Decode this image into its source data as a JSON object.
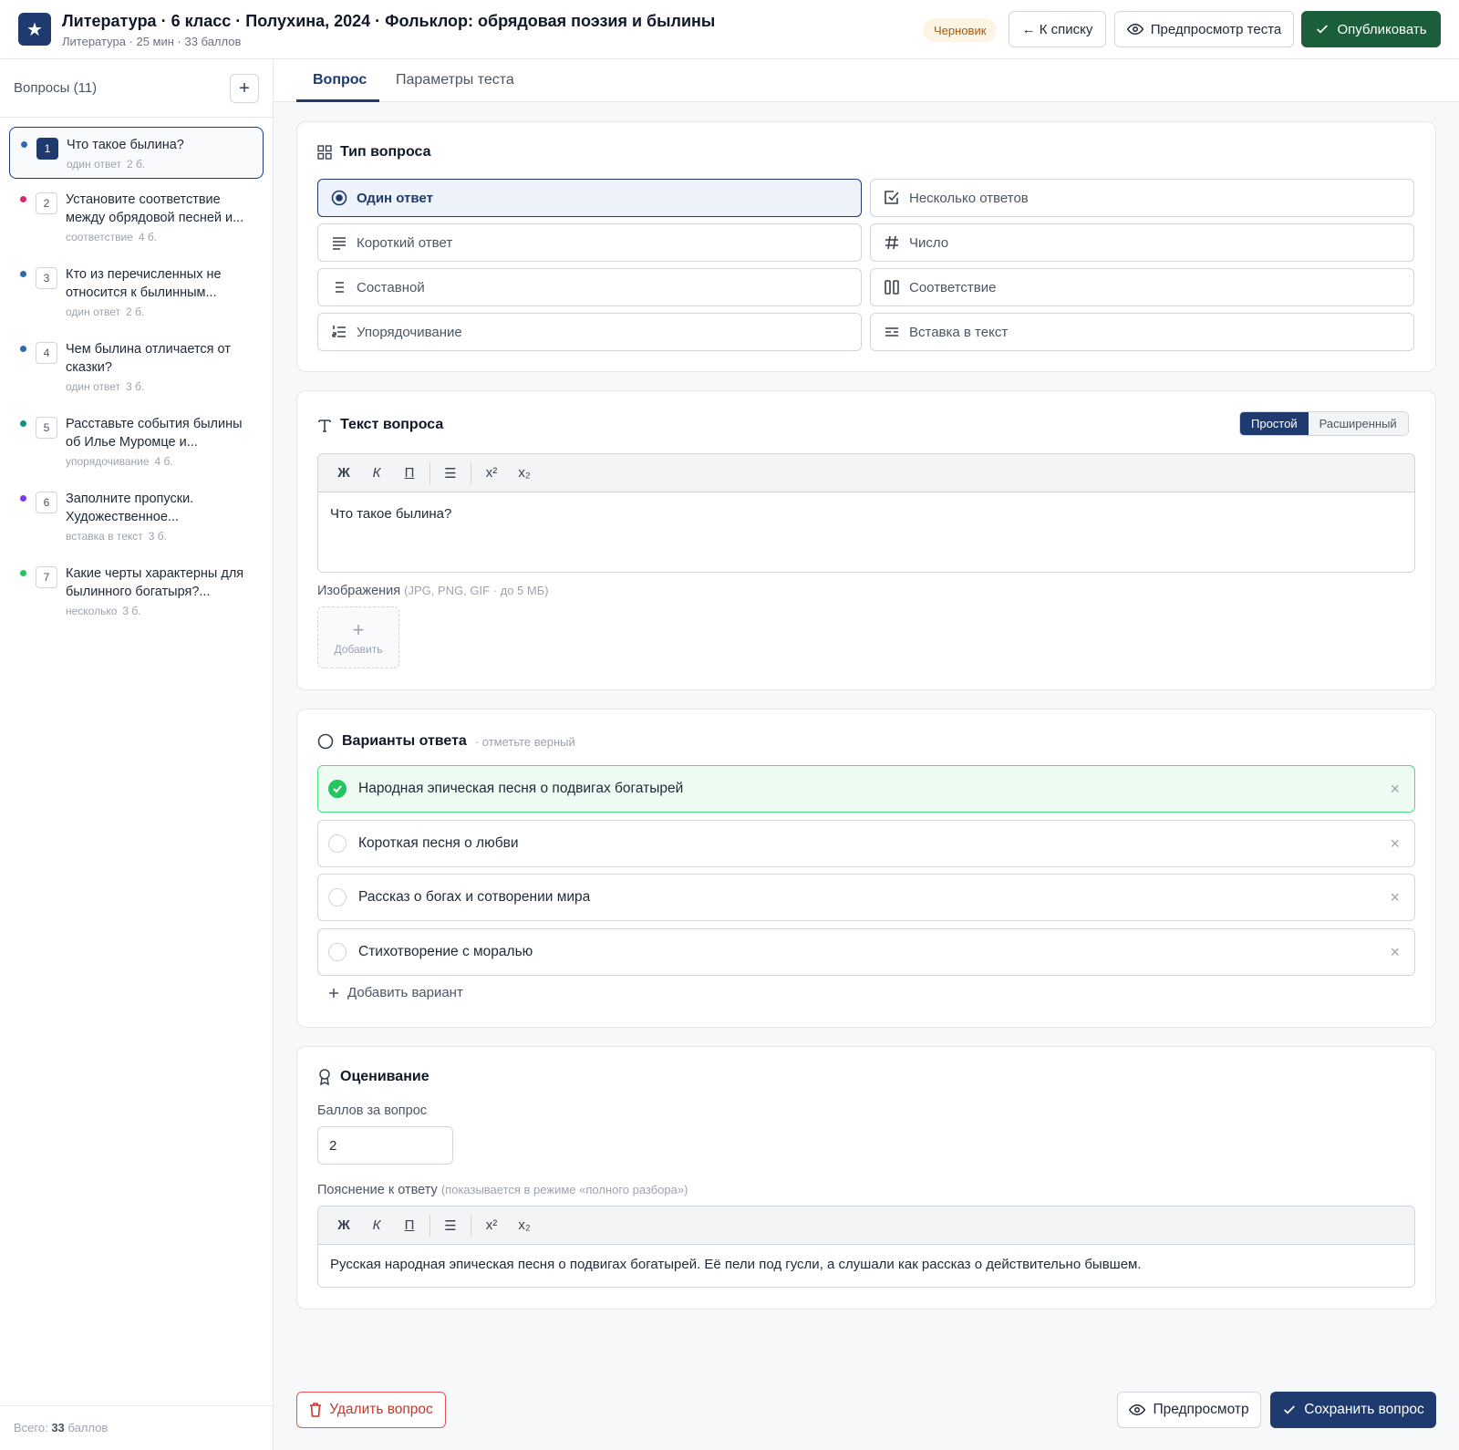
{
  "header": {
    "logo_glyph": "★",
    "title": "Литература · 6 класс · Полухина, 2024 · Фольклор: обрядовая поэзия и былины",
    "subtitle": "Литература · 25 мин · 33 баллов",
    "status_badge": "Черновик",
    "back_button": "← К списку",
    "preview_button": "Предпросмотр теста",
    "publish_button": "Опубликовать"
  },
  "sidebar": {
    "title": "Вопросы (11)",
    "add_glyph": "+",
    "items": [
      {
        "num": "1",
        "text": "Что такое былина?",
        "type": "один ответ",
        "score": "2 б.",
        "color": "#2b6cb0",
        "active": true
      },
      {
        "num": "2",
        "text": "Установите соответствие между обрядовой песней и...",
        "type": "соответствие",
        "score": "4 б.",
        "color": "#db2777"
      },
      {
        "num": "3",
        "text": "Кто из перечисленных не относится к былинным...",
        "type": "один ответ",
        "score": "2 б.",
        "color": "#2b6cb0"
      },
      {
        "num": "4",
        "text": "Чем былина отличается от сказки?",
        "type": "один ответ",
        "score": "3 б.",
        "color": "#2b6cb0"
      },
      {
        "num": "5",
        "text": "Расставьте события былины об Илье Муромце и...",
        "type": "упорядочивание",
        "score": "4 б.",
        "color": "#0e9488"
      },
      {
        "num": "6",
        "text": "Заполните пропуски. Художественное...",
        "type": "вставка в текст",
        "score": "3 б.",
        "color": "#7c3aed"
      },
      {
        "num": "7",
        "text": "Какие черты характерны для былинного богатыря?...",
        "type": "несколько",
        "score": "3 б.",
        "color": "#22c55e"
      }
    ],
    "footer_prefix": "Всего:",
    "footer_total": "33",
    "footer_suffix": "баллов"
  },
  "tabs": [
    {
      "label": "Вопрос",
      "active": true
    },
    {
      "label": "Параметры теста"
    }
  ],
  "question_type": {
    "title": "Тип вопроса",
    "options": [
      {
        "label": "Один ответ",
        "icon": "radio-icon",
        "active": true
      },
      {
        "label": "Несколько ответов",
        "icon": "checkbox-icon"
      },
      {
        "label": "Короткий ответ",
        "icon": "short-text-icon"
      },
      {
        "label": "Число",
        "icon": "hash-icon"
      },
      {
        "label": "Составной",
        "icon": "list-icon"
      },
      {
        "label": "Соответствие",
        "icon": "columns-icon"
      },
      {
        "label": "Упорядочивание",
        "icon": "ordered-list-icon"
      },
      {
        "label": "Вставка в текст",
        "icon": "insert-text-icon"
      }
    ]
  },
  "question_text": {
    "title": "Текст вопроса",
    "mode_simple": "Простой",
    "mode_advanced": "Расширенный",
    "toolbar": {
      "bold": "Ж",
      "italic": "К",
      "underline": "П",
      "list": "☰",
      "sup": "x²",
      "sub": "x₂"
    },
    "value": "Что такое былина?",
    "images_label": "Изображения",
    "images_hint": "(JPG, PNG, GIF · до 5 МБ)",
    "add_image": "Добавить"
  },
  "answers": {
    "title": "Варианты ответа",
    "hint": "· отметьте верный",
    "items": [
      {
        "text": "Народная эпическая песня о подвигах богатырей",
        "correct": true
      },
      {
        "text": "Короткая песня о любви"
      },
      {
        "text": "Рассказ о богах и сотворении мира"
      },
      {
        "text": "Стихотворение с моралью"
      }
    ],
    "delete_glyph": "×",
    "add_variant": "Добавить вариант"
  },
  "grading": {
    "title": "Оценивание",
    "score_label": "Баллов за вопрос",
    "score_value": "2",
    "explanation_label": "Пояснение к ответу",
    "explanation_hint": "(показывается в режиме «полного разбора»)",
    "explanation_value": "Русская народная эпическая песня о подвигах богатырей. Её пели под гусли, а слушали как рассказ о действительно бывшем."
  },
  "footer": {
    "delete_button": "Удалить вопрос",
    "preview_button": "Предпросмотр",
    "save_button": "Сохранить вопрос"
  },
  "colors": {
    "primary": "#1e3a6e",
    "publish": "#1b5e3a",
    "correct": "#22c55e",
    "danger": "#c0392b"
  }
}
